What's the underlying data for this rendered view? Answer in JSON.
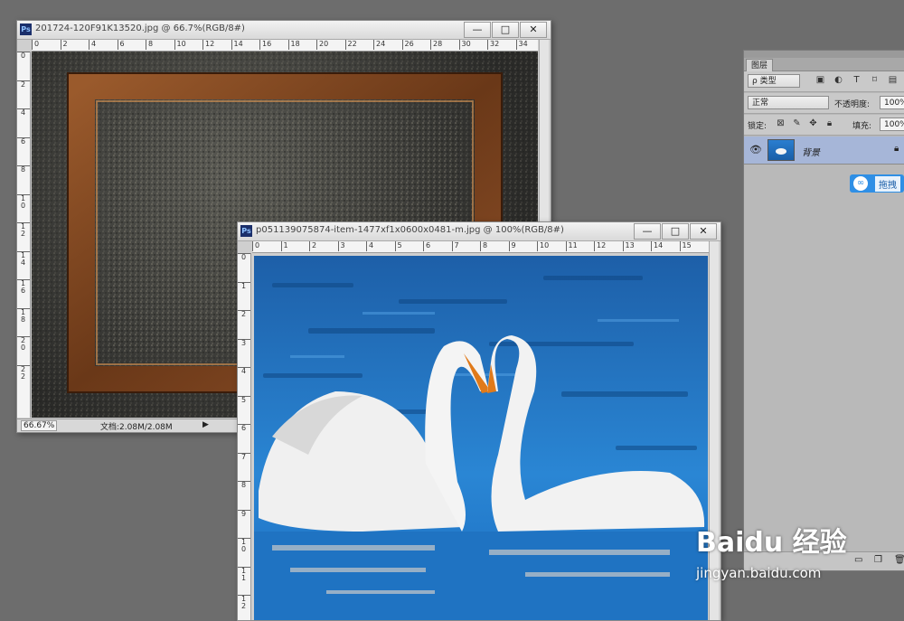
{
  "window1": {
    "title": "201724-120F91K13520.jpg @ 66.7%(RGB/8#)",
    "ruler_h": [
      "0",
      "2",
      "4",
      "6",
      "8",
      "10",
      "12",
      "14",
      "16",
      "18",
      "20",
      "22",
      "24",
      "26",
      "28",
      "30",
      "32",
      "34"
    ],
    "ruler_v": [
      "0",
      "2",
      "4",
      "6",
      "8",
      "1 0",
      "1 2",
      "1 4",
      "1 6",
      "1 8",
      "2 0",
      "2 2"
    ],
    "zoom": "66.67%",
    "doc_info": "文档:2.08M/2.08M",
    "buttons": {
      "minimize": "—",
      "maximize": "□",
      "close": "✕"
    }
  },
  "window2": {
    "title": "p051139075874-item-1477xf1x0600x0481-m.jpg @ 100%(RGB/8#)",
    "ruler_h": [
      "0",
      "1",
      "2",
      "3",
      "4",
      "5",
      "6",
      "7",
      "8",
      "9",
      "10",
      "11",
      "12",
      "13",
      "14",
      "15"
    ],
    "ruler_v": [
      "0",
      "1",
      "2",
      "3",
      "4",
      "5",
      "6",
      "7",
      "8",
      "9",
      "1 0",
      "1 1",
      "1 2"
    ],
    "buttons": {
      "minimize": "—",
      "maximize": "□",
      "close": "✕"
    }
  },
  "layers_panel": {
    "tab": "图层",
    "filter_kind": "ρ 类型",
    "blend_mode": "正常",
    "opacity_label": "不透明度:",
    "opacity_value": "100%",
    "lock_label": "锁定:",
    "fill_label": "填充:",
    "fill_value": "100%",
    "layer_name": "背景",
    "drag_hint": "拖拽"
  },
  "watermark": {
    "brand": "Baidu 经验",
    "url": "jingyan.baidu.com"
  },
  "colors": {
    "workspace": "#6d6d6d",
    "selected_layer": "#a6b6d8",
    "baidu_blue": "#2f8fe5",
    "water": "#1f6fb8"
  }
}
